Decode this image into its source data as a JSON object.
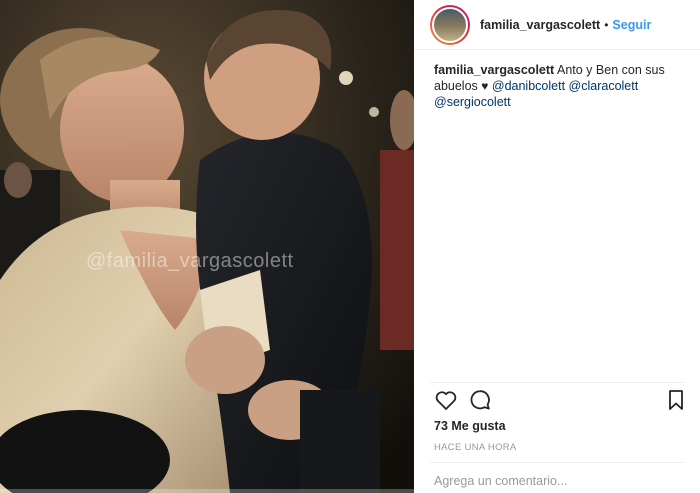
{
  "post": {
    "username": "familia_vargascolett",
    "separator": "•",
    "follow_label": "Seguir",
    "watermark": "@familia_vargascolett",
    "video_progress": 0.0,
    "caption": {
      "username": "familia_vargascolett",
      "text": "Anto y Ben con sus abuelos",
      "heart": "♥",
      "mentions": [
        "@danibcolett",
        "@claracolett",
        "@sergiocolett"
      ]
    },
    "actions": {
      "like_icon": "heart-outline-icon",
      "comment_icon": "comment-bubble-icon",
      "save_icon": "bookmark-icon"
    },
    "likes": "73 Me gusta",
    "time": "HACE UNA HORA",
    "comment_placeholder": "Agrega un comentario..."
  },
  "colors": {
    "link_blue": "#3897f0",
    "mention_blue": "#003569",
    "text": "#262626",
    "muted": "#999999",
    "divider": "#efefef"
  }
}
